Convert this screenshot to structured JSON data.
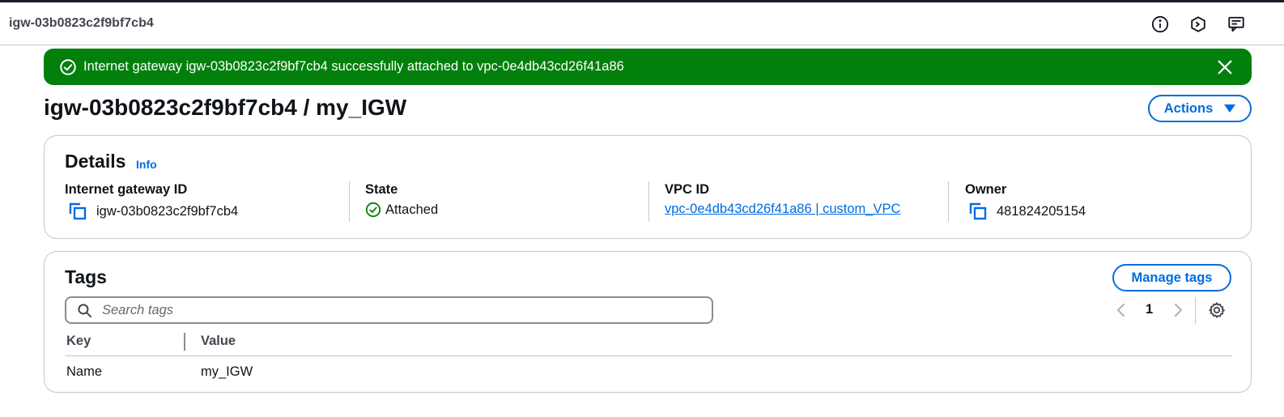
{
  "header": {
    "breadcrumb": "igw-03b0823c2f9bf7cb4",
    "icons": [
      "info-icon",
      "cloudshell-icon",
      "feedback-icon"
    ]
  },
  "flash": {
    "message": "Internet gateway igw-03b0823c2f9bf7cb4 successfully attached to vpc-0e4db43cd26f41a86",
    "status": "success",
    "color": "#037f0c"
  },
  "page": {
    "title": "igw-03b0823c2f9bf7cb4 / my_IGW",
    "actions_label": "Actions"
  },
  "details": {
    "heading": "Details",
    "info_link": "Info",
    "fields": [
      {
        "label": "Internet gateway ID",
        "value": "igw-03b0823c2f9bf7cb4"
      },
      {
        "label": "State",
        "value": "Attached"
      },
      {
        "label": "VPC ID",
        "value": "vpc-0e4db43cd26f41a86 | custom_VPC"
      },
      {
        "label": "Owner",
        "value": "481824205154"
      }
    ]
  },
  "tags": {
    "heading": "Tags",
    "manage_label": "Manage tags",
    "search_placeholder": "Search tags",
    "search_value": "",
    "page_number": "1",
    "columns": [
      "Key",
      "Value"
    ],
    "rows": [
      [
        "Name",
        "my_IGW"
      ]
    ]
  },
  "colors": {
    "accent": "#006ce0",
    "success": "#037f0c",
    "border": "#c6c6cd",
    "text": "#0f141a"
  }
}
